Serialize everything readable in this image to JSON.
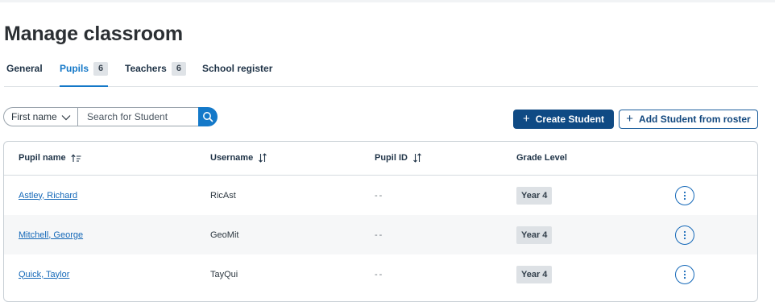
{
  "title": "Manage classroom",
  "tabs": [
    {
      "label": "General",
      "count": null
    },
    {
      "label": "Pupils",
      "count": "6"
    },
    {
      "label": "Teachers",
      "count": "6"
    },
    {
      "label": "School register",
      "count": null
    }
  ],
  "active_tab": "Pupils",
  "search": {
    "field_select": "First name",
    "placeholder": "Search for Student"
  },
  "actions": {
    "create": "Create Student",
    "add_from_roster": "Add Student from roster"
  },
  "table": {
    "columns": [
      "Pupil name",
      "Username",
      "Pupil ID",
      "Grade Level"
    ],
    "rows": [
      {
        "name": "Astley, Richard",
        "username": "RicAst",
        "pupil_id": "--",
        "grade": "Year 4"
      },
      {
        "name": "Mitchell, George",
        "username": "GeoMit",
        "pupil_id": "--",
        "grade": "Year 4"
      },
      {
        "name": "Quick, Taylor",
        "username": "TayQui",
        "pupil_id": "--",
        "grade": "Year 4"
      }
    ]
  },
  "colors": {
    "accent": "#1478c8",
    "primary_button": "#0f4a84",
    "link": "#1468b8"
  },
  "icons": [
    "chevron-down-icon",
    "search-icon",
    "plus-icon",
    "sort-asc-icon",
    "sort-icon",
    "more-vertical-icon"
  ]
}
